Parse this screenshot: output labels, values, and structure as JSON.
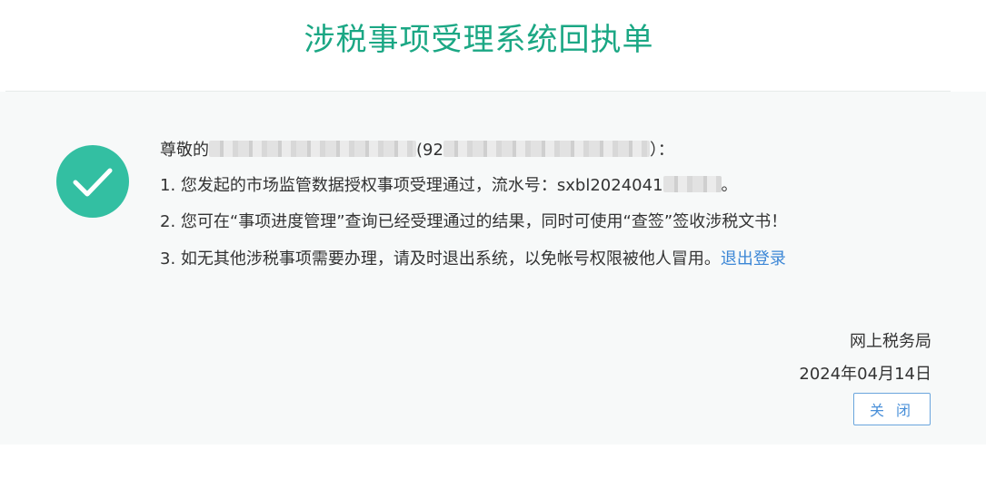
{
  "title": "涉税事项受理系统回执单",
  "greeting": {
    "prefix": "尊敬的",
    "name_redacted": "",
    "paren_open": "(92",
    "code_redacted": "",
    "suffix": "）："
  },
  "lines": [
    {
      "prefix": "1. 您发起的市场监管数据授权事项受理通过，流水号：sxbl2024041",
      "serial_redacted": "",
      "suffix": "。"
    },
    {
      "text": "2. 您可在“事项进度管理”查询已经受理通过的结果，同时可使用“查签”签收涉税文书！"
    },
    {
      "prefix": "3. 如无其他涉税事项需要办理，请及时退出系统，以免帐号权限被他人冒用。",
      "link": "退出登录"
    }
  ],
  "issuer": "网上税务局",
  "date": "2024年04月14日",
  "close_button": "关 闭",
  "colors": {
    "title": "#1ba784",
    "check_circle": "#33bfa2",
    "link": "#3c87d6",
    "panel_bg": "#f7f9f9"
  },
  "icons": {
    "status": "check-circle-icon"
  }
}
